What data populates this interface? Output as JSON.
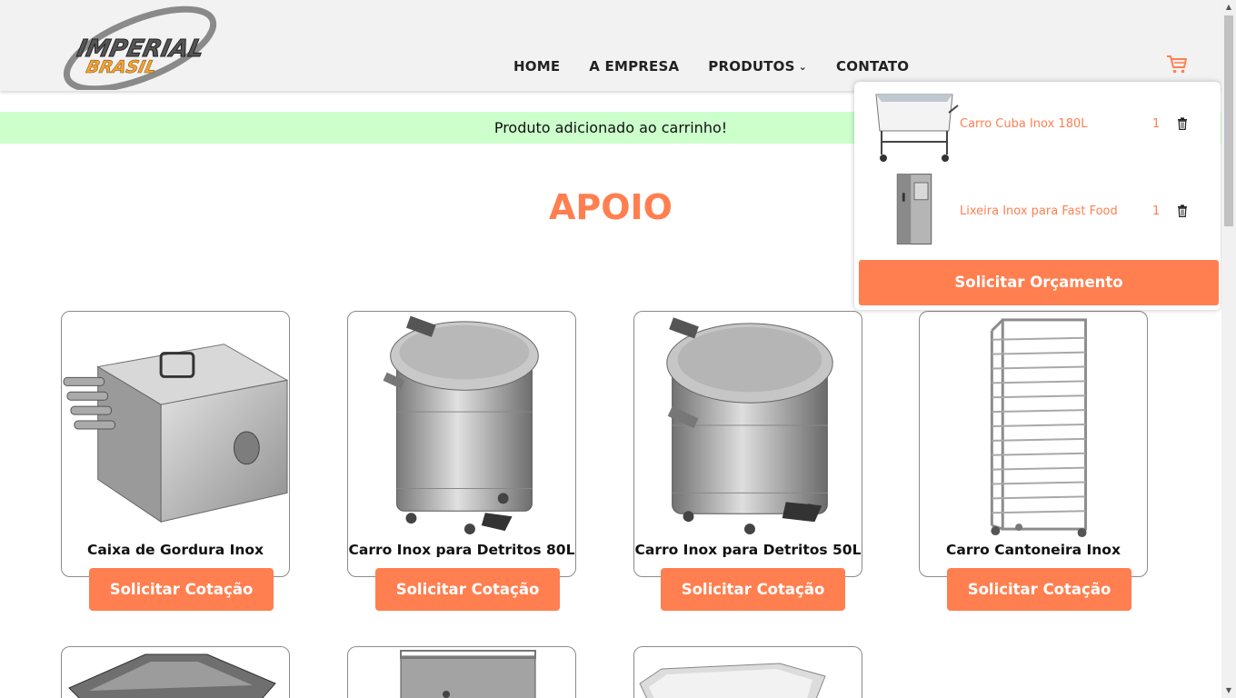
{
  "brand": {
    "logo_top": "IMPERIAL",
    "logo_bottom": "BRASIL"
  },
  "nav": {
    "home": "HOME",
    "empresa": "A EMPRESA",
    "produtos": "PRODUTOS",
    "contato": "CONTATO"
  },
  "alert": "Produto adicionado ao carrinho!",
  "section_title": "APOIO",
  "products": [
    {
      "name": "Caixa de Gordura Inox",
      "button": "Solicitar Cotação"
    },
    {
      "name": "Carro Inox para Detritos 80L",
      "button": "Solicitar Cotação"
    },
    {
      "name": "Carro Inox para Detritos 50L",
      "button": "Solicitar Cotação"
    },
    {
      "name": "Carro Cantoneira Inox",
      "button": "Solicitar Cotação"
    }
  ],
  "cart": {
    "items": [
      {
        "name": "Carro Cuba Inox 180L",
        "qty": "1"
      },
      {
        "name": "Lixeira Inox para Fast Food",
        "qty": "1"
      }
    ],
    "order_button": "Solicitar Orçamento"
  },
  "colors": {
    "accent": "#ff7f50",
    "alert_bg": "#ccffcc",
    "header_bg": "#f2f2f2"
  },
  "icons": [
    "cart-icon",
    "chevron-down-icon",
    "trash-icon"
  ]
}
